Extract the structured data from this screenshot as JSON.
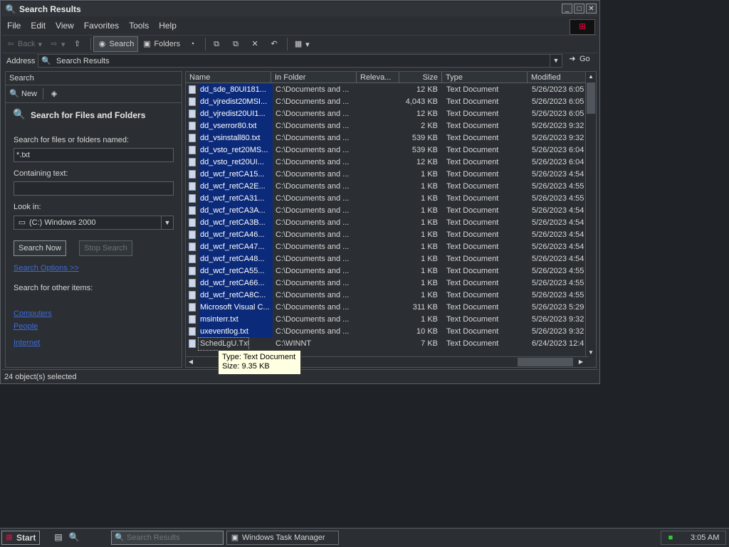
{
  "window": {
    "title": "Search Results",
    "minimize": "_",
    "maximize": "□",
    "close": "✕"
  },
  "menu": [
    "File",
    "Edit",
    "View",
    "Favorites",
    "Tools",
    "Help"
  ],
  "toolbar": {
    "back": "Back",
    "search": "Search",
    "folders": "Folders"
  },
  "address": {
    "label": "Address",
    "value": "Search Results",
    "go": "Go"
  },
  "search_pane": {
    "header": "Search",
    "new_label": "New",
    "title": "Search for Files and Folders",
    "named_label": "Search for files or folders named:",
    "named_value": "*.txt",
    "containing_label": "Containing text:",
    "containing_value": "",
    "look_in_label": "Look in:",
    "look_in_value": "(C:) Windows 2000",
    "search_now": "Search Now",
    "stop_search": "Stop Search",
    "options_link": "Search Options >>",
    "other_label": "Search for other items:",
    "other_links": [
      "Computers",
      "People",
      "Internet"
    ]
  },
  "columns": [
    "Name",
    "In Folder",
    "Releva...",
    "Size",
    "Type",
    "Modified"
  ],
  "rows": [
    {
      "name": "dd_sde_80UI181...",
      "folder": "C:\\Documents and ...",
      "size": "12 KB",
      "type": "Text Document",
      "modified": "5/26/2023 6:05",
      "selected": true
    },
    {
      "name": "dd_vjredist20MSI...",
      "folder": "C:\\Documents and ...",
      "size": "4,043 KB",
      "type": "Text Document",
      "modified": "5/26/2023 6:05",
      "selected": true
    },
    {
      "name": "dd_vjredist20UI1...",
      "folder": "C:\\Documents and ...",
      "size": "12 KB",
      "type": "Text Document",
      "modified": "5/26/2023 6:05",
      "selected": true
    },
    {
      "name": "dd_vserror80.txt",
      "folder": "C:\\Documents and ...",
      "size": "2 KB",
      "type": "Text Document",
      "modified": "5/26/2023 9:32",
      "selected": true
    },
    {
      "name": "dd_vsinstall80.txt",
      "folder": "C:\\Documents and ...",
      "size": "539 KB",
      "type": "Text Document",
      "modified": "5/26/2023 9:32",
      "selected": true
    },
    {
      "name": "dd_vsto_ret20MS...",
      "folder": "C:\\Documents and ...",
      "size": "539 KB",
      "type": "Text Document",
      "modified": "5/26/2023 6:04",
      "selected": true
    },
    {
      "name": "dd_vsto_ret20UI...",
      "folder": "C:\\Documents and ...",
      "size": "12 KB",
      "type": "Text Document",
      "modified": "5/26/2023 6:04",
      "selected": true
    },
    {
      "name": "dd_wcf_retCA15...",
      "folder": "C:\\Documents and ...",
      "size": "1 KB",
      "type": "Text Document",
      "modified": "5/26/2023 4:54",
      "selected": true
    },
    {
      "name": "dd_wcf_retCA2E...",
      "folder": "C:\\Documents and ...",
      "size": "1 KB",
      "type": "Text Document",
      "modified": "5/26/2023 4:55",
      "selected": true
    },
    {
      "name": "dd_wcf_retCA31...",
      "folder": "C:\\Documents and ...",
      "size": "1 KB",
      "type": "Text Document",
      "modified": "5/26/2023 4:55",
      "selected": true
    },
    {
      "name": "dd_wcf_retCA3A...",
      "folder": "C:\\Documents and ...",
      "size": "1 KB",
      "type": "Text Document",
      "modified": "5/26/2023 4:54",
      "selected": true
    },
    {
      "name": "dd_wcf_retCA3B...",
      "folder": "C:\\Documents and ...",
      "size": "1 KB",
      "type": "Text Document",
      "modified": "5/26/2023 4:54",
      "selected": true
    },
    {
      "name": "dd_wcf_retCA46...",
      "folder": "C:\\Documents and ...",
      "size": "1 KB",
      "type": "Text Document",
      "modified": "5/26/2023 4:54",
      "selected": true
    },
    {
      "name": "dd_wcf_retCA47...",
      "folder": "C:\\Documents and ...",
      "size": "1 KB",
      "type": "Text Document",
      "modified": "5/26/2023 4:54",
      "selected": true
    },
    {
      "name": "dd_wcf_retCA48...",
      "folder": "C:\\Documents and ...",
      "size": "1 KB",
      "type": "Text Document",
      "modified": "5/26/2023 4:54",
      "selected": true
    },
    {
      "name": "dd_wcf_retCA55...",
      "folder": "C:\\Documents and ...",
      "size": "1 KB",
      "type": "Text Document",
      "modified": "5/26/2023 4:55",
      "selected": true
    },
    {
      "name": "dd_wcf_retCA66...",
      "folder": "C:\\Documents and ...",
      "size": "1 KB",
      "type": "Text Document",
      "modified": "5/26/2023 4:55",
      "selected": true
    },
    {
      "name": "dd_wcf_retCA8C...",
      "folder": "C:\\Documents and ...",
      "size": "1 KB",
      "type": "Text Document",
      "modified": "5/26/2023 4:55",
      "selected": true
    },
    {
      "name": "Microsoft Visual C...",
      "folder": "C:\\Documents and ...",
      "size": "311 KB",
      "type": "Text Document",
      "modified": "5/26/2023 5:29",
      "selected": true
    },
    {
      "name": "msinterr.txt",
      "folder": "C:\\Documents and ...",
      "size": "1 KB",
      "type": "Text Document",
      "modified": "5/26/2023 9:32",
      "selected": true
    },
    {
      "name": "uxeventlog.txt",
      "folder": "C:\\Documents and ...",
      "size": "10 KB",
      "type": "Text Document",
      "modified": "5/26/2023 9:32",
      "selected": true
    },
    {
      "name": "SchedLgU.Txt",
      "folder": "C:\\WINNT",
      "size": "7 KB",
      "type": "Text Document",
      "modified": "6/24/2023 12:4",
      "selected": false
    }
  ],
  "tooltip": {
    "line1": "Type: Text Document",
    "line2": "Size: 9.35 KB"
  },
  "status": "24 object(s) selected",
  "taskbar": {
    "start": "Start",
    "tasks": [
      "Search Results",
      "Windows Task Manager"
    ],
    "clock": "3:05 AM"
  }
}
